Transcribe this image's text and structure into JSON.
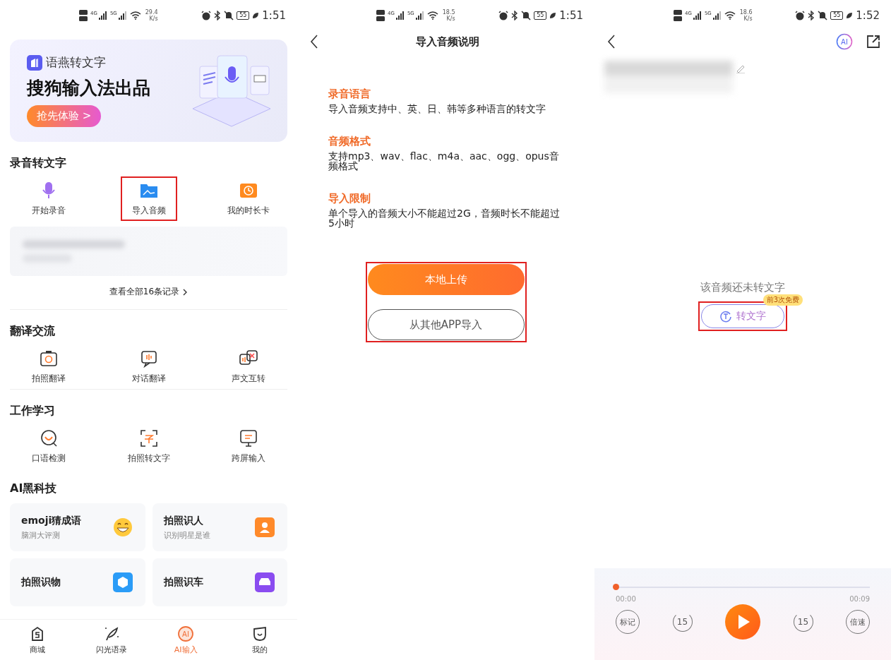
{
  "home": {
    "status_bar": {
      "network_1": "4G",
      "network_2": "5G",
      "speed": "29.4",
      "speed_unit": "K/s",
      "battery": "55",
      "time": "1:51"
    },
    "banner": {
      "brand": "语燕转文字",
      "headline": "搜狗输入法出品",
      "button": "抢先体验 >"
    },
    "recording": {
      "title": "录音转文字",
      "items": [
        {
          "label": "开始录音",
          "highlighted": false
        },
        {
          "label": "导入音频",
          "highlighted": true
        },
        {
          "label": "我的时长卡",
          "highlighted": false
        }
      ],
      "more_link": "查看全部16条记录"
    },
    "sections": [
      {
        "title": "翻译交流",
        "items": [
          {
            "label": "拍照翻译"
          },
          {
            "label": "对话翻译"
          },
          {
            "label": "声文互转"
          }
        ]
      },
      {
        "title": "工作学习",
        "items": [
          {
            "label": "口语检测"
          },
          {
            "label": "拍照转文字"
          },
          {
            "label": "跨屏输入"
          }
        ]
      }
    ],
    "ai_tech": {
      "title": "AI黑科技",
      "cards": [
        {
          "title": "emoji猜成语",
          "subtitle": "脑洞大评测"
        },
        {
          "title": "拍照识人",
          "subtitle": "识别明星是谁"
        },
        {
          "title": "拍照识物"
        },
        {
          "title": "拍照识车"
        }
      ]
    },
    "nav": [
      {
        "label": "商城",
        "selected": false
      },
      {
        "label": "闪光语录",
        "selected": false
      },
      {
        "label": "AI输入",
        "selected": true,
        "icon_text": "AI"
      },
      {
        "label": "我的",
        "selected": false
      }
    ]
  },
  "import_guide": {
    "status_bar": {
      "network_1": "4G",
      "network_2": "5G",
      "speed": "18.5",
      "speed_unit": "K/s",
      "battery": "55",
      "time": "1:51"
    },
    "title": "导入音频说明",
    "sections": [
      {
        "heading": "录音语言",
        "body": "导入音频支持中、英、日、韩等多种语言的转文字"
      },
      {
        "heading": "音频格式",
        "body": "支持mp3、wav、flac、m4a、aac、ogg、opus音频格式"
      },
      {
        "heading": "导入限制",
        "body": "单个导入的音频大小不能超过2G，音频时长不能超过5小时"
      }
    ],
    "buttons": [
      {
        "label": "本地上传",
        "kind": "primary"
      },
      {
        "label": "从其他APP导入",
        "kind": "outline"
      }
    ],
    "buttons_highlighted": true
  },
  "audio_detail": {
    "status_bar": {
      "network_1": "4G",
      "network_2": "5G",
      "speed": "18.6",
      "speed_unit": "K/s",
      "battery": "55",
      "time": "1:52"
    },
    "ai_button": "AI",
    "empty_message": "该音频还未转文字",
    "transcribe_button": {
      "label": "转文字",
      "badge": "前3次免费",
      "highlighted": true
    },
    "player": {
      "level": 0,
      "elapsed": "00:00",
      "duration": "00:09",
      "mark_button": "标记",
      "rewind": "15",
      "forward": "15",
      "speed_button": "倍速"
    }
  }
}
